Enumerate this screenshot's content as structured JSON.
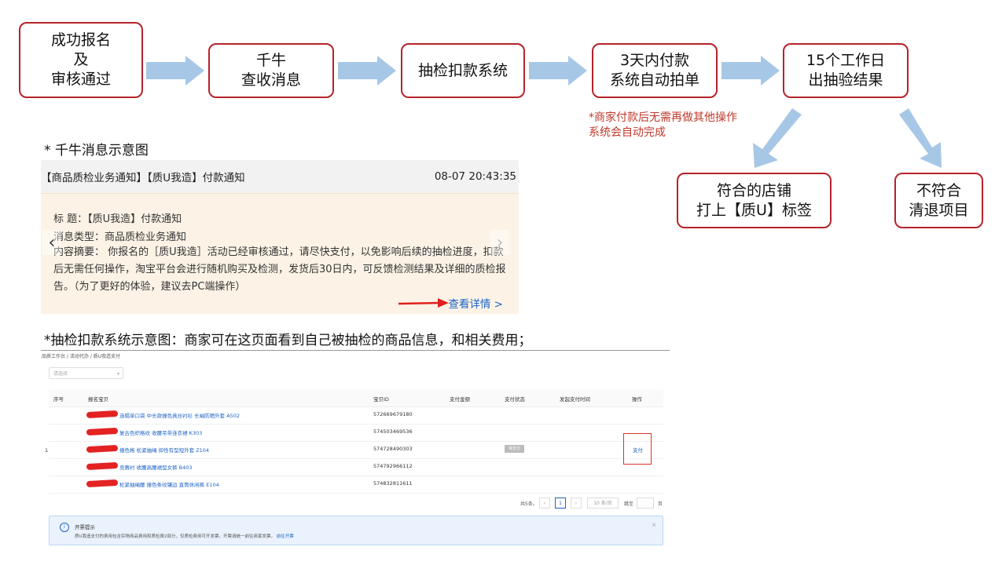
{
  "flow": {
    "step1": "成功报名\n及\n审核通过",
    "step2": "千牛\n查收消息",
    "step3": "抽检扣款系统",
    "step4": "3天内付款\n系统自动拍单",
    "step5": "15个工作日\n出抽验结果",
    "step5_note": "*商家付款后无需再做其他操作\n  系统会自动完成",
    "result_yes": "符合的店铺\n打上【质U】标签",
    "result_no": "不符合\n清退项目",
    "arrow_color": "#a7c7e6",
    "border_color": "#b5232a"
  },
  "qianniu": {
    "section_title": "* 千牛消息示意图",
    "header_title": "【商品质检业务通知】【质U我造】付款通知",
    "header_time": "08-07 20:43:35",
    "title_line": "标      题：【质U我造】付款通知",
    "type_line": "消息类型：商品质检业务通知",
    "summary": "内容摘要：  你报名的［质U我造］活动已经审核通过，请尽快支付，以免影响后续的抽检进度，扣款后无需任何操作，淘宝平台会进行随机购买及检测，发货后30日内，可反馈检测结果及详细的质检报告。（为了更好的体验，建议去PC端操作）",
    "prev_icon": "chevron-left-icon",
    "next_icon": "chevron-right-icon",
    "detail_link": "查看详情 >"
  },
  "payment": {
    "section_title": "*抽检扣款系统示意图：商家可在这页面看到自己被抽检的商品信息，和相关费用；",
    "breadcrumb": "品质工作台 / 活动代办 / 质U我造支付",
    "filter_placeholder": "请选择",
    "columns": [
      "序号",
      "报名宝贝",
      "宝贝ID",
      "支付金额",
      "支付状态",
      "发起支付时间",
      "操作"
    ],
    "rows": [
      {
        "product": "连帽单口袋 中长款撞色真丝衬衫 长袖防晒外套 A502",
        "id": "572669679180"
      },
      {
        "product": "复古色织格纹 收腰吊带连衣裙 K303",
        "id": "574503469536"
      },
      {
        "product": "撞色格 松紧抽绳 抑性有型短外套 Z104",
        "id": "574728490303"
      },
      {
        "product": "竞赛衬 收腰高腰裙型女裤 B403",
        "id": "574792966112"
      },
      {
        "product": "松紧抽绳腰 撞色条纹镶边 直筒休闲裤 E104",
        "id": "574832811611"
      }
    ],
    "seq": "1",
    "status": "待支付",
    "action": "支付",
    "pager_total": "共5条。",
    "pager_page": "1",
    "pager_size": "10 条/页",
    "pager_goto": "跳至",
    "pager_unit": "页",
    "notice_title": "开票提示",
    "notice_text": "质U我造支付的费用包含实物商品费用和质检费2部分，仅质检费用可开发票，开票请统一前往商家发票。",
    "notice_link": "前往开票",
    "notice_close": "×"
  }
}
